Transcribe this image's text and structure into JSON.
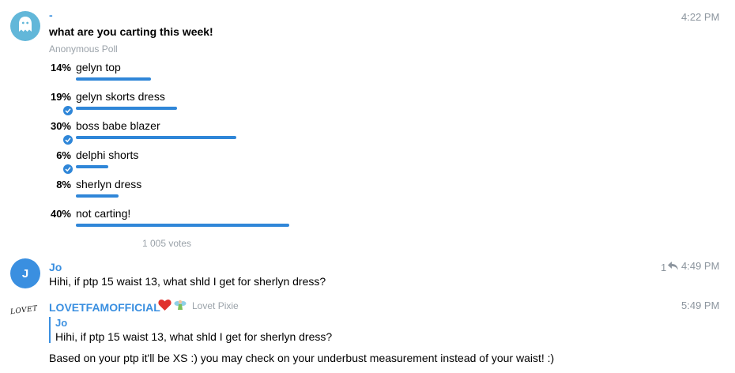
{
  "poll_message": {
    "sender": "-",
    "time": "4:22 PM",
    "question": "what are you carting this week!",
    "poll_type": "Anonymous Poll",
    "options": [
      {
        "percent_label": "14%",
        "label": "gelyn top",
        "fraction": 0.14,
        "chosen": false
      },
      {
        "percent_label": "19%",
        "label": "gelyn skorts dress",
        "fraction": 0.19,
        "chosen": true
      },
      {
        "percent_label": "30%",
        "label": "boss babe blazer",
        "fraction": 0.3,
        "chosen": true
      },
      {
        "percent_label": "6%",
        "label": "delphi shorts",
        "fraction": 0.06,
        "chosen": true
      },
      {
        "percent_label": "8%",
        "label": "sherlyn dress",
        "fraction": 0.08,
        "chosen": false
      },
      {
        "percent_label": "40%",
        "label": "not carting!",
        "fraction": 0.4,
        "chosen": false
      }
    ],
    "votes": "1 005 votes",
    "avatar_icon": "ghost-icon"
  },
  "jo_message": {
    "avatar_initial": "J",
    "sender": "Jo",
    "text": "Hihi, if ptp 15 waist 13, what shld I get for sherlyn dress?",
    "reply_count": "1",
    "time": "4:49 PM"
  },
  "lovet_message": {
    "avatar_text": "LOVET",
    "sender": "LOVETFAMOFFICIAL",
    "badge": "Lovet Pixie",
    "time": "5:49 PM",
    "quote_name": "Jo",
    "quote_text": "Hihi, if ptp 15 waist 13, what shld I get for sherlyn dress?",
    "text": "Based on your ptp it'll be XS :) you may check on your underbust measurement instead of your waist! :)"
  },
  "colors": {
    "accent": "#3a8fe0",
    "bar": "#2f86d8",
    "ghost_avatar": "#62b7d9",
    "heart": "#e0322d"
  }
}
